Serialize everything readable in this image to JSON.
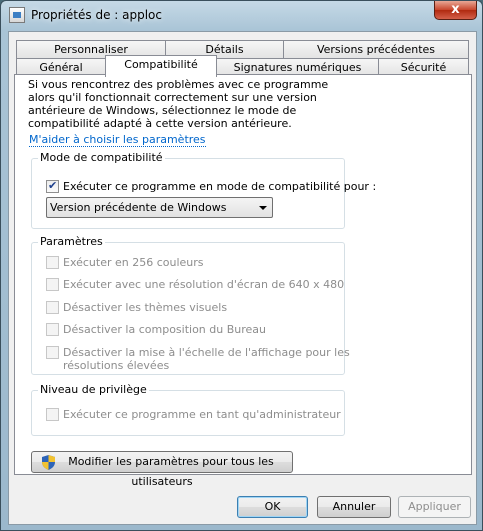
{
  "window": {
    "title": "Propriétés de : apploc",
    "close_glyph": "x"
  },
  "tabs_row1": [
    {
      "label": "Personnaliser"
    },
    {
      "label": "Détails"
    },
    {
      "label": "Versions précédentes"
    }
  ],
  "tabs_row2": [
    {
      "label": "Général"
    },
    {
      "label": "Compatibilité",
      "active": true
    },
    {
      "label": "Signatures numériques"
    },
    {
      "label": "Sécurité"
    }
  ],
  "compat": {
    "description": "Si vous rencontrez des problèmes avec ce programme alors qu'il fonctionnait correctement sur une version antérieure de Windows, sélectionnez le mode de compatibilité adapté à cette version antérieure.",
    "help_link": "M'aider à choisir les paramètres",
    "mode_group": {
      "title": "Mode de compatibilité",
      "checkbox_label": "Exécuter ce programme en mode de compatibilité pour :",
      "checked": true,
      "select_value": "Version précédente de Windows"
    },
    "settings_group": {
      "title": "Paramètres",
      "items": [
        {
          "label": "Exécuter en 256 couleurs"
        },
        {
          "label": "Exécuter avec une résolution d'écran de 640 x 480"
        },
        {
          "label": "Désactiver les thèmes visuels"
        },
        {
          "label": "Désactiver la composition du Bureau"
        },
        {
          "label_line1": "Désactiver la mise à l'échelle de l'affichage pour les",
          "label_line2": "résolutions élevées"
        }
      ]
    },
    "privilege_group": {
      "title": "Niveau de privilège",
      "item": "Exécuter ce programme en tant qu'administrateur"
    },
    "all_users_button": "Modifier les paramètres pour tous les utilisateurs"
  },
  "footer": {
    "ok": "OK",
    "cancel": "Annuler",
    "apply": "Appliquer"
  },
  "colors": {
    "link": "#0066cc",
    "tab_border": "#898c95",
    "close": "#c7442b"
  }
}
